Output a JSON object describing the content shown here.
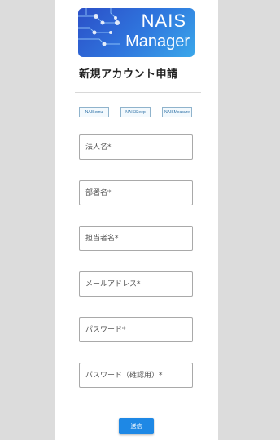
{
  "logo": {
    "line1": "NAIS",
    "line2": "Manager"
  },
  "page_title": "新規アカウント申請",
  "brands": [
    {
      "label": "NAISemu"
    },
    {
      "label": "NAISSleep"
    },
    {
      "label": "NAISMeasure"
    }
  ],
  "form": {
    "corporate_name": {
      "placeholder": "法人名*",
      "value": ""
    },
    "department_name": {
      "placeholder": "部署名*",
      "value": ""
    },
    "person_name": {
      "placeholder": "担当者名*",
      "value": ""
    },
    "email": {
      "placeholder": "メールアドレス*",
      "value": ""
    },
    "password": {
      "placeholder": "パスワード*",
      "value": ""
    },
    "password_confirm": {
      "placeholder": "パスワード（確認用）*",
      "value": ""
    },
    "submit_label": "送信"
  },
  "colors": {
    "background": "#dcdcdc",
    "panel": "#ffffff",
    "accent": "#1e88e5",
    "logo_gradient_start": "#2b4fc7",
    "logo_gradient_end": "#3aa7ea"
  }
}
